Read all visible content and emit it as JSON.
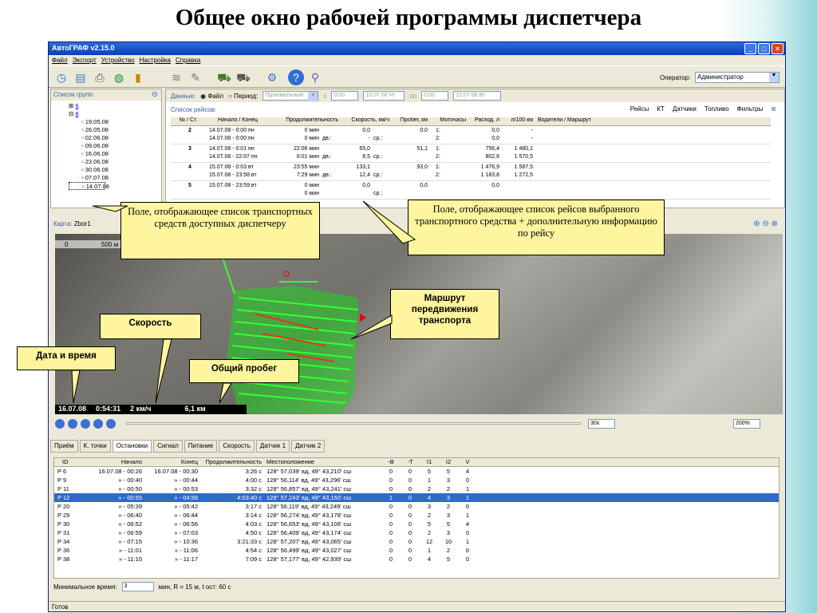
{
  "slide_title": "Общее окно рабочей программы диспетчера",
  "window": {
    "title": "АвтоГРАФ v2.15.0"
  },
  "menu": [
    "Файл",
    "Экспорт",
    "Устройство",
    "Настройка",
    "Справка"
  ],
  "operator": {
    "label": "Оператор:",
    "value": "Администратор"
  },
  "groups": {
    "title": "Список групп:",
    "items": [
      "6",
      "8",
      "19.05.08",
      "26.05.08",
      "02.06.08",
      "09.06.08",
      "16.06.08",
      "23.06.08",
      "30.06.08",
      "07.07.08",
      "14.07.08"
    ]
  },
  "data_bar": {
    "label": "Данные:",
    "file": "Файл",
    "period": "Период:",
    "period_value": "Произвольный",
    "from": "с",
    "from_time": "0:00",
    "from_date": "10.07.08 Чт",
    "to": "по",
    "to_time": "0:00",
    "to_date": "15.07.08 Вт"
  },
  "trips": {
    "title": "Список рейсов:",
    "tabs": [
      "Рейсы",
      "КТ",
      "Датчики",
      "Топливо",
      "Фильтры"
    ],
    "columns": [
      "№ / Ст.",
      "Начало / Конец",
      "Продолжительность",
      "Скорость, км/ч",
      "Пробег, км",
      "Моточасы",
      "Расход, л",
      "л/100 км",
      "Водители / Маршрут"
    ],
    "rows": [
      {
        "num": "2",
        "times": [
          "14.07.08 - 0:00 пн",
          "14.07.08 - 0:00 пн"
        ],
        "dur": [
          "0 мин",
          "0 мин"
        ],
        "dv": [
          "",
          "дв.:"
        ],
        "sp": [
          "",
          "ср.:"
        ],
        "speed": [
          "0,0",
          "-"
        ],
        "km": "0,0",
        "moto": [
          "1:",
          "2:"
        ],
        "fuel": [
          "0,0",
          "0,0"
        ],
        "l100": [
          "-",
          "-"
        ]
      },
      {
        "num": "3",
        "times": [
          "14.07.08 - 0:01 пн",
          "14.07.08 - 22:07 пн"
        ],
        "dur": [
          "22:06 мин",
          "6:01 мин"
        ],
        "dv": [
          "",
          "дв.:"
        ],
        "sp": [
          "",
          "ср.:"
        ],
        "speed": [
          "65,0",
          "8,5"
        ],
        "km": "51,1",
        "moto": [
          "1:",
          "2:"
        ],
        "fuel": [
          "756,4",
          "802,6"
        ],
        "l100": [
          "1 480,1",
          "1 570,5"
        ]
      },
      {
        "num": "4",
        "times": [
          "15.07.08 - 0:03 вт",
          "15.07.08 - 23:58 вт"
        ],
        "dur": [
          "23:55 мин",
          "7:29 мин"
        ],
        "dv": [
          "",
          "дв.:"
        ],
        "sp": [
          "",
          "ср.:"
        ],
        "speed": [
          "133,1",
          "12,4"
        ],
        "km": "93,0",
        "moto": [
          "1:",
          "2:"
        ],
        "fuel": [
          "1 476,9",
          "1 183,8"
        ],
        "l100": [
          "1 587,5",
          "1 272,5"
        ]
      },
      {
        "num": "5",
        "times": [
          "15.07.08 - 23:59 вт",
          ""
        ],
        "dur": [
          "0 мин",
          "0 мин"
        ],
        "dv": [
          "",
          ""
        ],
        "sp": [
          "",
          "ср.:"
        ],
        "speed": [
          "0,0",
          ""
        ],
        "km": "0,0",
        "moto": [
          "",
          ""
        ],
        "fuel": [
          "0,0",
          ""
        ],
        "l100": [
          "",
          ""
        ]
      }
    ]
  },
  "map": {
    "label": "Карта:",
    "name": "Zbor1",
    "scale": "500 м",
    "scale_zero": "0",
    "date": "16.07.08",
    "time": "0:54:31",
    "speed": "2 км/ч",
    "distance": "6,1 км"
  },
  "playbar": {
    "speed": "30x",
    "zoom": "200%"
  },
  "bottom_tabs": [
    "Приём",
    "К. точки",
    "Остановки",
    "Сигнал",
    "Питание",
    "Скорость",
    "Датчик 1",
    "Датчик 2"
  ],
  "stops": {
    "columns": [
      "ID",
      "Начало",
      "Конец",
      "Продолжительность",
      "Местоположение",
      "-В",
      "-Т",
      "I1",
      "I2",
      "V"
    ],
    "rows": [
      [
        "6",
        "16.07.08 - 00:26",
        "16.07.08 - 00:30",
        "3:26 с",
        "128° 57,039' вд, 49° 43,210' сш",
        "0",
        "0",
        "5",
        "5",
        "4"
      ],
      [
        "9",
        "» - 00:40",
        "» - 00:44",
        "4:00 с",
        "128° 56,114' вд, 49° 43,296' сш",
        "0",
        "0",
        "1",
        "3",
        "0"
      ],
      [
        "11",
        "» - 00:50",
        "» - 00:53",
        "3:32 с",
        "128° 56,857' вд, 49° 43,241' сш",
        "0",
        "0",
        "2",
        "2",
        "1"
      ],
      [
        "12",
        "» - 00:55",
        "» - 04:58",
        "4:03:40 с",
        "128° 57,243' вд, 49° 43,150' сш",
        "1",
        "0",
        "4",
        "3",
        "1"
      ],
      [
        "20",
        "» - 05:39",
        "» - 05:42",
        "3:17 с",
        "128° 56,119' вд, 49° 43,249' сш",
        "0",
        "0",
        "3",
        "2",
        "0"
      ],
      [
        "29",
        "» - 06:40",
        "» - 06:44",
        "3:14 с",
        "128° 56,274' вд, 49° 43,178' сш",
        "0",
        "0",
        "2",
        "3",
        "1"
      ],
      [
        "30",
        "» - 06:52",
        "» - 06:56",
        "4:03 с",
        "128° 56,653' вд, 49° 43,106' сш",
        "0",
        "0",
        "5",
        "5",
        "4"
      ],
      [
        "31",
        "» - 06:59",
        "» - 07:03",
        "4:50 с",
        "128° 56,409' вд, 49° 43,174' сш",
        "0",
        "0",
        "2",
        "3",
        "0"
      ],
      [
        "34",
        "» - 07:15",
        "» - 10:36",
        "3:21:33 с",
        "128° 57,207' вд, 49° 43,065' сш",
        "0",
        "0",
        "12",
        "10",
        "1"
      ],
      [
        "36",
        "» - 11:01",
        "» - 11:06",
        "4:54 с",
        "128° 56,499' вд, 49° 43,027' сш",
        "0",
        "0",
        "1",
        "2",
        "0"
      ],
      [
        "38",
        "» - 11:10",
        "» - 11:17",
        "7:09 с",
        "128° 57,177' вд, 49° 42,939' сш",
        "0",
        "0",
        "4",
        "5",
        "0"
      ]
    ],
    "selected_index": 3
  },
  "min_time": {
    "label": "Минимальное время:",
    "value": "3",
    "suffix": "мин, R = 15 м, t ост: 60 с"
  },
  "status": "Готов",
  "callouts": {
    "vehicles": "Поле, отображающее список транспортных средств доступных диспетчеру",
    "trips": "Поле, отображающее список рейсов выбранного транспортного средства + дополнительную информацию по рейсу",
    "route": "Маршрут передвижения транспорта",
    "speed": "Скорость",
    "datetime": "Дата и время",
    "mileage": "Общий пробег"
  }
}
